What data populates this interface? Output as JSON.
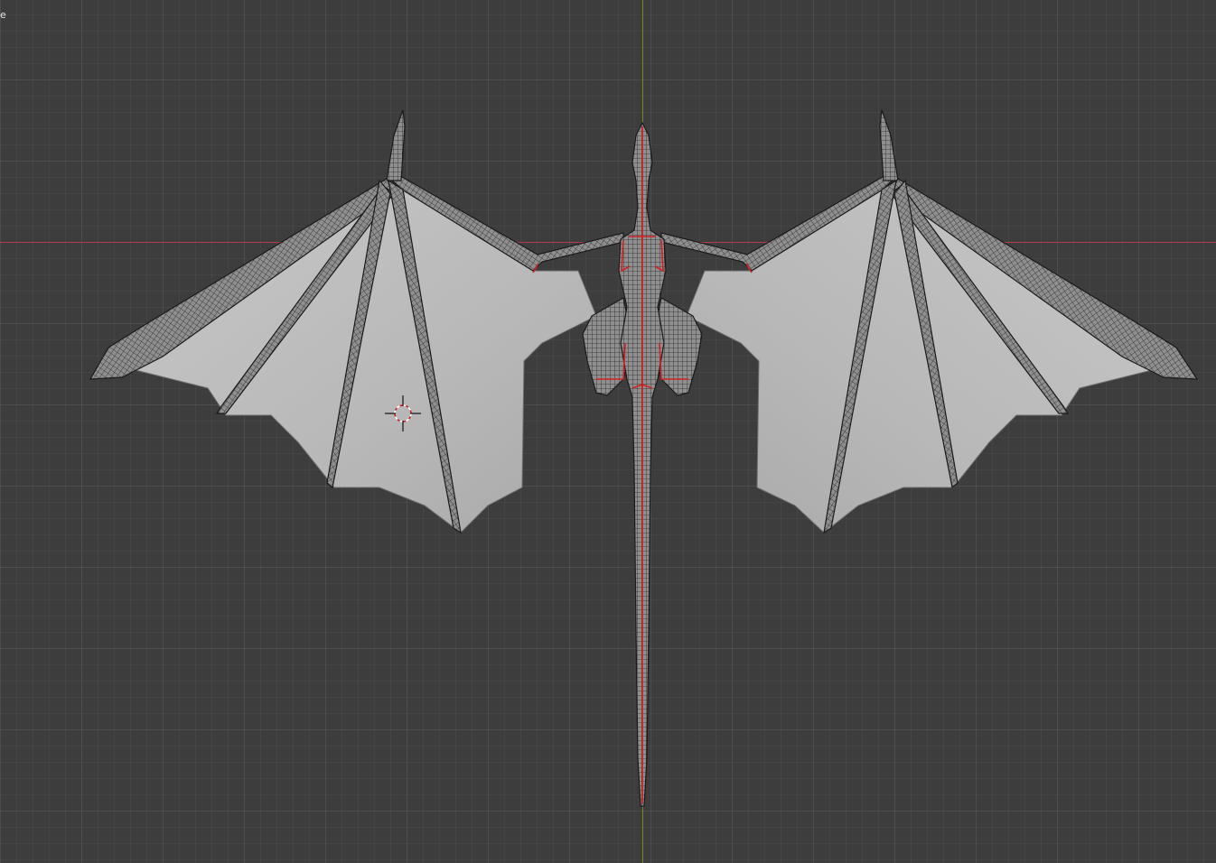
{
  "viewport": {
    "corner_label": "e"
  },
  "colors": {
    "background": "#3d3d3d",
    "x_axis": "#b23c4c",
    "y_axis": "#6a8e1f",
    "mesh_fill": "#bdbdbd",
    "mesh_wire": "#1e1e1e",
    "seam": "#d22020"
  },
  "icons": {
    "cursor": "3d-cursor-icon"
  }
}
